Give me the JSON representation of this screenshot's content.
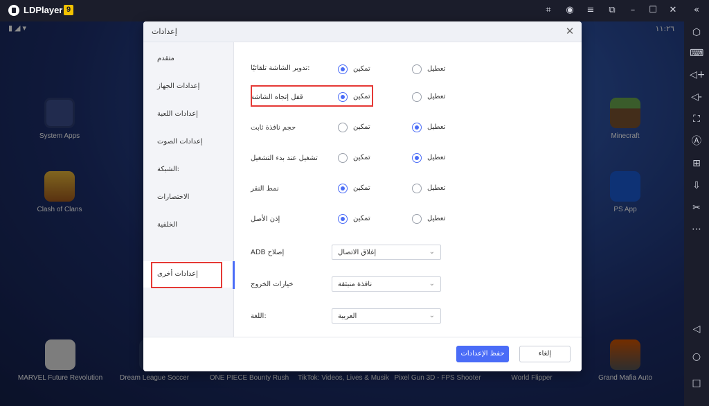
{
  "titlebar": {
    "app_name": "LDPlayer",
    "version_badge": "9",
    "icons": [
      "gamepad-icon",
      "account-icon",
      "menu-icon",
      "screenshot-icon",
      "minimize-icon",
      "maximize-icon",
      "close-icon",
      "collapse-icon"
    ]
  },
  "statusbar": {
    "clock": "١١:٢٦"
  },
  "desktop": {
    "apps_left": [
      {
        "label": "System Apps"
      },
      {
        "label": "Clash of Clans"
      }
    ],
    "apps_right": [
      {
        "label": "Minecraft"
      },
      {
        "label": "PS App"
      }
    ],
    "dock": [
      {
        "label": "MARVEL Future Revolution"
      },
      {
        "label": "Dream League Soccer"
      },
      {
        "label": "ONE PIECE Bounty Rush"
      },
      {
        "label": "TikTok: Videos, Lives & Musik"
      },
      {
        "label": "Pixel Gun 3D - FPS Shooter"
      },
      {
        "label": "World Flipper"
      },
      {
        "label": "Grand Mafia Auto"
      }
    ]
  },
  "dialog": {
    "title": "إعدادات",
    "nav": [
      {
        "label": "متقدم"
      },
      {
        "label": "إعدادات الجهاز"
      },
      {
        "label": "إعدادات اللعبة"
      },
      {
        "label": "إعدادات الصوت"
      },
      {
        "label": "الشبكة:"
      },
      {
        "label": "الاختصارات"
      },
      {
        "label": "الخلفية"
      },
      {
        "label": "إعدادات أخرى"
      }
    ],
    "enable_label": "تمكين",
    "disable_label": "تعطيل",
    "toggles": [
      {
        "label": "تدوير الشاشة تلقائيًا:",
        "selected": "enable"
      },
      {
        "label": "قفل إتجاه الشاشة",
        "selected": "enable"
      },
      {
        "label": "حجم نافذة ثابت",
        "selected": "disable"
      },
      {
        "label": "تشغيل عند بدء التشغيل",
        "selected": "disable"
      },
      {
        "label": "نمط النقر",
        "selected": "enable"
      },
      {
        "label": "إذن الأصل",
        "selected": "enable"
      }
    ],
    "selects": [
      {
        "label": "ADB إصلاح",
        "value": "إغلاق الاتصال"
      },
      {
        "label": "خيارات الخروج",
        "value": "نافذة منبثقة"
      },
      {
        "label": "اللغة:",
        "value": "العربية"
      }
    ],
    "save_label": "حفظ الإعدادات",
    "cancel_label": "إلغاء"
  },
  "colors": {
    "accent": "#4a6cf7",
    "highlight": "#e53935"
  }
}
